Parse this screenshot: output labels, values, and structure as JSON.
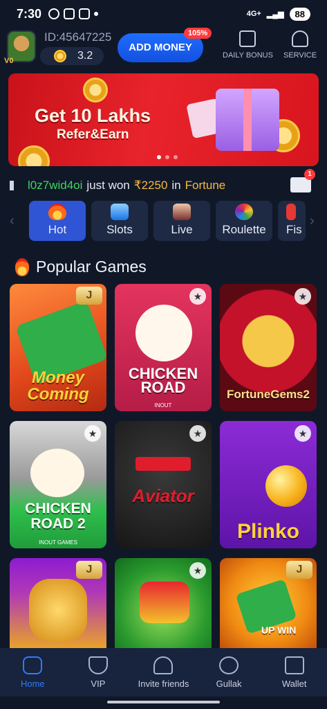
{
  "status_bar": {
    "time": "7:30",
    "network": "4G+",
    "battery": "88"
  },
  "header": {
    "user_id": "ID:45647225",
    "vip_level": "V0",
    "balance": "3.2",
    "add_money_label": "ADD MONEY",
    "add_money_badge": "105%",
    "daily_bonus_label": "DAILY BONUS",
    "service_label": "SERVICE"
  },
  "banner": {
    "line1": "Get 10 Lakhs",
    "line2": "Refer&Earn",
    "slide_count": 3,
    "active_slide": 1
  },
  "ticker": {
    "user": "l0z7wid4oi",
    "mid": "just won",
    "amount": "₹2250",
    "in": "in",
    "game": "Fortune",
    "mail_count": "1"
  },
  "categories": [
    {
      "label": "Hot",
      "active": true
    },
    {
      "label": "Slots",
      "active": false
    },
    {
      "label": "Live",
      "active": false
    },
    {
      "label": "Roulette",
      "active": false
    },
    {
      "label": "Fis",
      "active": false
    }
  ],
  "section": {
    "title": "Popular Games"
  },
  "games": [
    {
      "title": "Money Coming",
      "subtitle": "",
      "tag": "J"
    },
    {
      "title": "CHICKEN ROAD",
      "subtitle": "INOUT",
      "tag": "fav"
    },
    {
      "title": "FortuneGems2",
      "subtitle": "",
      "tag": "fav"
    },
    {
      "title": "CHICKEN ROAD 2",
      "subtitle": "INOUT GAMES",
      "tag": "fav"
    },
    {
      "title": "Aviator",
      "subtitle": "",
      "tag": "fav"
    },
    {
      "title": "Plinko",
      "subtitle": "",
      "tag": "fav"
    },
    {
      "title": "",
      "subtitle": "",
      "tag": "J"
    },
    {
      "title": "",
      "subtitle": "",
      "tag": "fav"
    },
    {
      "title": "UP WIN",
      "subtitle": "",
      "tag": "J"
    }
  ],
  "nav": {
    "home": "Home",
    "vip": "VIP",
    "invite": "Invite friends",
    "gullak": "Gullak",
    "wallet": "Wallet"
  },
  "colors": {
    "accent": "#2e7bff",
    "banner": "#e8232b",
    "winner": "#3fd65f",
    "amount": "#f5b942"
  }
}
